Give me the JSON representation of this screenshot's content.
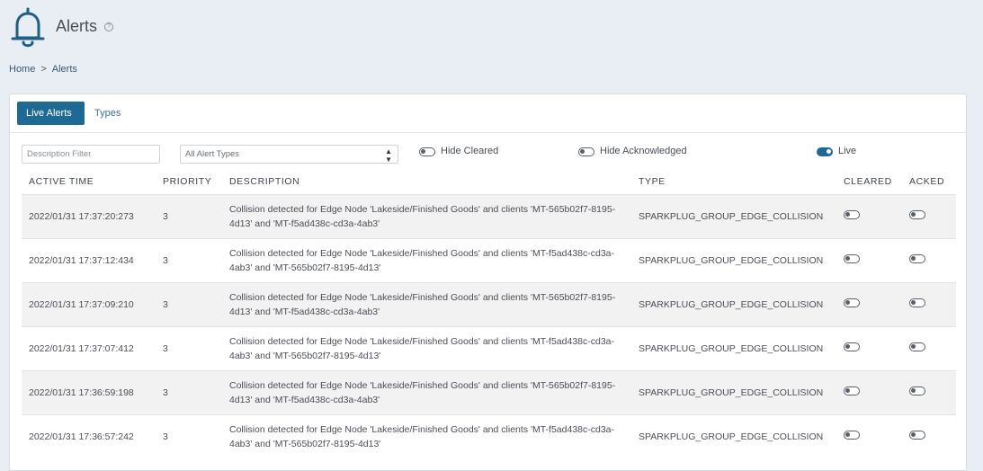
{
  "header": {
    "title": "Alerts",
    "help": "?"
  },
  "breadcrumb": {
    "home": "Home",
    "separator": ">",
    "current": "Alerts"
  },
  "tabs": [
    {
      "label": "Live Alerts",
      "active": true
    },
    {
      "label": "Types",
      "active": false
    }
  ],
  "filters": {
    "description_placeholder": "Description Filter",
    "alert_type_selected": "All Alert Types",
    "hide_cleared_label": "Hide Cleared",
    "hide_cleared_on": false,
    "hide_acknowledged_label": "Hide Acknowledged",
    "hide_acknowledged_on": false,
    "live_label": "Live",
    "live_on": true
  },
  "table": {
    "columns": [
      "ACTIVE TIME",
      "PRIORITY",
      "DESCRIPTION",
      "TYPE",
      "CLEARED",
      "ACKED"
    ],
    "rows": [
      {
        "active_time": "2022/01/31 17:37:20:273",
        "priority": "3",
        "description": "Collision detected for Edge Node 'Lakeside/Finished Goods' and clients 'MT-565b02f7-8195-4d13' and 'MT-f5ad438c-cd3a-4ab3'",
        "type": "SPARKPLUG_GROUP_EDGE_COLLISION",
        "cleared": false,
        "acked": false
      },
      {
        "active_time": "2022/01/31 17:37:12:434",
        "priority": "3",
        "description": "Collision detected for Edge Node 'Lakeside/Finished Goods' and clients 'MT-f5ad438c-cd3a-4ab3' and 'MT-565b02f7-8195-4d13'",
        "type": "SPARKPLUG_GROUP_EDGE_COLLISION",
        "cleared": false,
        "acked": false
      },
      {
        "active_time": "2022/01/31 17:37:09:210",
        "priority": "3",
        "description": "Collision detected for Edge Node 'Lakeside/Finished Goods' and clients 'MT-565b02f7-8195-4d13' and 'MT-f5ad438c-cd3a-4ab3'",
        "type": "SPARKPLUG_GROUP_EDGE_COLLISION",
        "cleared": false,
        "acked": false
      },
      {
        "active_time": "2022/01/31 17:37:07:412",
        "priority": "3",
        "description": "Collision detected for Edge Node 'Lakeside/Finished Goods' and clients 'MT-f5ad438c-cd3a-4ab3' and 'MT-565b02f7-8195-4d13'",
        "type": "SPARKPLUG_GROUP_EDGE_COLLISION",
        "cleared": false,
        "acked": false
      },
      {
        "active_time": "2022/01/31 17:36:59:198",
        "priority": "3",
        "description": "Collision detected for Edge Node 'Lakeside/Finished Goods' and clients 'MT-565b02f7-8195-4d13' and 'MT-f5ad438c-cd3a-4ab3'",
        "type": "SPARKPLUG_GROUP_EDGE_COLLISION",
        "cleared": false,
        "acked": false
      },
      {
        "active_time": "2022/01/31 17:36:57:242",
        "priority": "3",
        "description": "Collision detected for Edge Node 'Lakeside/Finished Goods' and clients 'MT-f5ad438c-cd3a-4ab3' and 'MT-565b02f7-8195-4d13'",
        "type": "SPARKPLUG_GROUP_EDGE_COLLISION",
        "cleared": false,
        "acked": false
      }
    ]
  },
  "colors": {
    "accent": "#1e6a94",
    "background": "#e9eef4",
    "row_alt": "#f2f2f2"
  },
  "icons": {
    "header": "bell-icon",
    "help": "help-icon",
    "select": "sort-arrows-icon"
  }
}
